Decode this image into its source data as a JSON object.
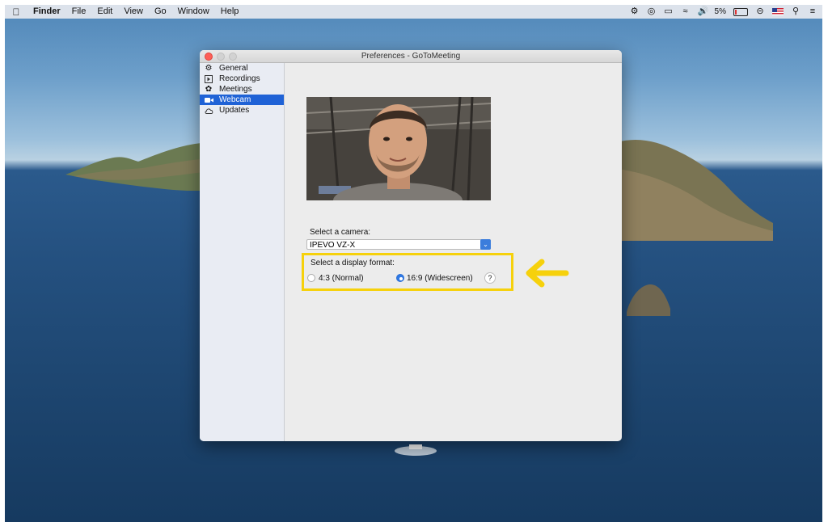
{
  "menubar": {
    "apple_icon": "apple-icon",
    "items": [
      "Finder",
      "File",
      "Edit",
      "View",
      "Go",
      "Window",
      "Help"
    ],
    "battery_percent": "5%",
    "status_icons": [
      "gear-icon",
      "creative-cloud-icon",
      "airplay-icon",
      "wifi-icon",
      "volume-icon",
      "battery-icon",
      "do-not-disturb-icon",
      "us-flag-icon",
      "search-icon",
      "control-center-icon"
    ]
  },
  "window": {
    "title": "Preferences - GoToMeeting",
    "sidebar": {
      "items": [
        {
          "label": "General",
          "icon": "gear-icon",
          "selected": false
        },
        {
          "label": "Recordings",
          "icon": "play-icon",
          "selected": false
        },
        {
          "label": "Meetings",
          "icon": "meetings-icon",
          "selected": false
        },
        {
          "label": "Webcam",
          "icon": "webcam-icon",
          "selected": true
        },
        {
          "label": "Updates",
          "icon": "cloud-icon",
          "selected": false
        }
      ]
    },
    "webcam": {
      "camera_label": "Select a camera:",
      "camera_value": "IPEVO VZ-X",
      "format_label": "Select a display format:",
      "format_normal": "4:3 (Normal)",
      "format_widescreen": "16:9 (Widescreen)",
      "selected_format": "16:9 (Widescreen)",
      "help": "?"
    }
  },
  "annotation": {
    "highlight_color": "#f6d10c",
    "arrow_color": "#f6d10c"
  },
  "colors": {
    "selection": "#1f62d6",
    "accent": "#2f79e6"
  }
}
